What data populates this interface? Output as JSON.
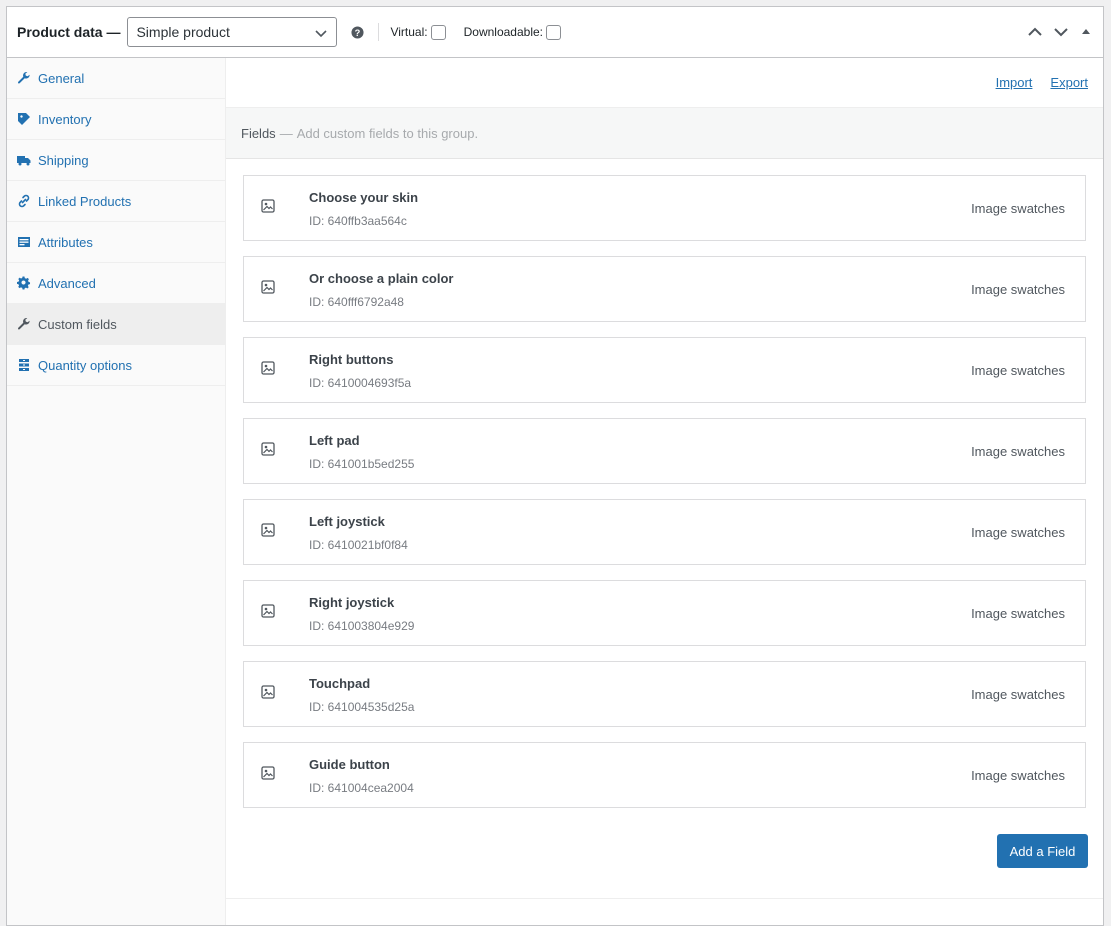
{
  "header": {
    "title": "Product data —",
    "product_type": "Simple product",
    "virtual_label": "Virtual:",
    "downloadable_label": "Downloadable:"
  },
  "sidebar": {
    "items": [
      {
        "label": "General",
        "icon": "wrench-icon"
      },
      {
        "label": "Inventory",
        "icon": "tag-icon"
      },
      {
        "label": "Shipping",
        "icon": "truck-icon"
      },
      {
        "label": "Linked Products",
        "icon": "link-icon"
      },
      {
        "label": "Attributes",
        "icon": "list-icon"
      },
      {
        "label": "Advanced",
        "icon": "gear-icon"
      },
      {
        "label": "Custom fields",
        "icon": "wrench-icon",
        "active": true
      },
      {
        "label": "Quantity options",
        "icon": "stack-icon"
      }
    ]
  },
  "main": {
    "import_label": "Import",
    "export_label": "Export",
    "fields_label": "Fields",
    "fields_dash": "—",
    "fields_hint": "Add custom fields to this group.",
    "fields": [
      {
        "name": "Choose your skin",
        "id": "ID: 640ffb3aa564c",
        "type": "Image swatches"
      },
      {
        "name": "Or choose a plain color",
        "id": "ID: 640fff6792a48",
        "type": "Image swatches"
      },
      {
        "name": "Right buttons",
        "id": "ID: 6410004693f5a",
        "type": "Image swatches"
      },
      {
        "name": "Left pad",
        "id": "ID: 641001b5ed255",
        "type": "Image swatches"
      },
      {
        "name": "Left joystick",
        "id": "ID: 6410021bf0f84",
        "type": "Image swatches"
      },
      {
        "name": "Right joystick",
        "id": "ID: 641003804e929",
        "type": "Image swatches"
      },
      {
        "name": "Touchpad",
        "id": "ID: 641004535d25a",
        "type": "Image swatches"
      },
      {
        "name": "Guide button",
        "id": "ID: 641004cea2004",
        "type": "Image swatches"
      }
    ],
    "add_button_label": "Add a Field"
  },
  "colors": {
    "accent": "#2271b1",
    "text": "#3c434a",
    "border": "#c3c4c7"
  }
}
